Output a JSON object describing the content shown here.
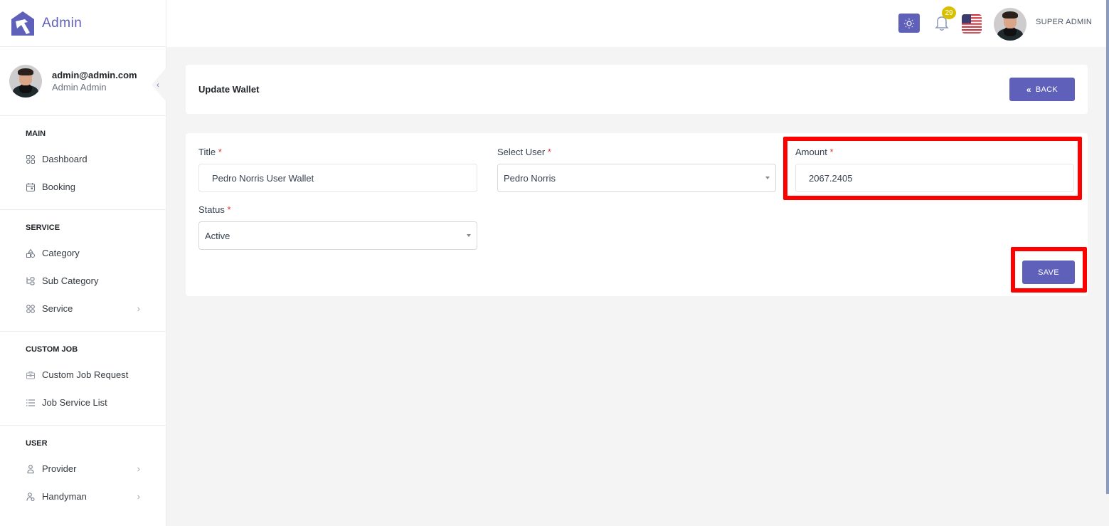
{
  "brand": {
    "name": "Admin",
    "icon": "hammer-house-logo"
  },
  "profile": {
    "email": "admin@admin.com",
    "name": "Admin Admin"
  },
  "sidebar": {
    "sections": [
      {
        "heading": "MAIN",
        "items": [
          {
            "label": "Dashboard",
            "icon": "grid-icon",
            "has_submenu": false
          },
          {
            "label": "Booking",
            "icon": "calendar-icon",
            "has_submenu": false
          }
        ]
      },
      {
        "heading": "SERVICE",
        "items": [
          {
            "label": "Category",
            "icon": "shapes-icon",
            "has_submenu": false
          },
          {
            "label": "Sub Category",
            "icon": "hierarchy-icon",
            "has_submenu": false
          },
          {
            "label": "Service",
            "icon": "grid-circles-icon",
            "has_submenu": true
          }
        ]
      },
      {
        "heading": "CUSTOM JOB",
        "items": [
          {
            "label": "Custom Job Request",
            "icon": "briefcase-icon",
            "has_submenu": false
          },
          {
            "label": "Job Service List",
            "icon": "list-icon",
            "has_submenu": false
          }
        ]
      },
      {
        "heading": "USER",
        "items": [
          {
            "label": "Provider",
            "icon": "user-icon",
            "has_submenu": true
          },
          {
            "label": "Handyman",
            "icon": "user-gear-icon",
            "has_submenu": true
          }
        ]
      }
    ]
  },
  "header": {
    "notification_count": "29",
    "user_label": "SUPER ADMIN",
    "theme_icon": "sun-icon",
    "language_icon": "us-flag-icon"
  },
  "page": {
    "title": "Update Wallet",
    "back_label": "BACK",
    "save_label": "SAVE"
  },
  "form": {
    "title": {
      "label": "Title",
      "required": "*",
      "value": "Pedro Norris User Wallet"
    },
    "user": {
      "label": "Select User",
      "required": "*",
      "value": "Pedro Norris"
    },
    "amount": {
      "label": "Amount",
      "required": "*",
      "value": "2067.2405"
    },
    "status": {
      "label": "Status",
      "required": "*",
      "value": "Active"
    }
  },
  "colors": {
    "accent": "#5f60b9",
    "badge": "#d8c000",
    "required": "#e3342f",
    "highlight": "#ff0000"
  }
}
